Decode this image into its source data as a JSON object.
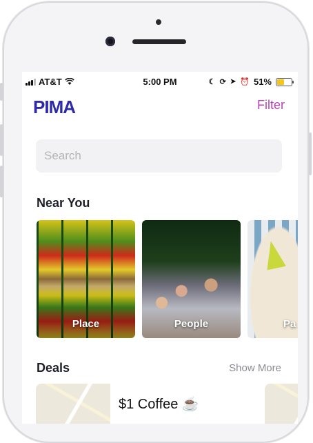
{
  "status_bar": {
    "carrier": "AT&T",
    "time": "5:00 PM",
    "battery": "51%",
    "battery_level": 0.51,
    "battery_color": "#f5c518"
  },
  "header": {
    "logo": "PIMA",
    "filter_label": "Filter",
    "logo_color": "#2f2aa8",
    "filter_color": "#b743b5"
  },
  "search": {
    "placeholder": "Search"
  },
  "near_you": {
    "title": "Near You",
    "cards": [
      {
        "label": "Place"
      },
      {
        "label": "People"
      },
      {
        "label": "Pa"
      }
    ]
  },
  "deals": {
    "title": "Deals",
    "show_more": "Show More",
    "items": [
      {
        "title": "$1 Coffee ☕"
      }
    ]
  }
}
